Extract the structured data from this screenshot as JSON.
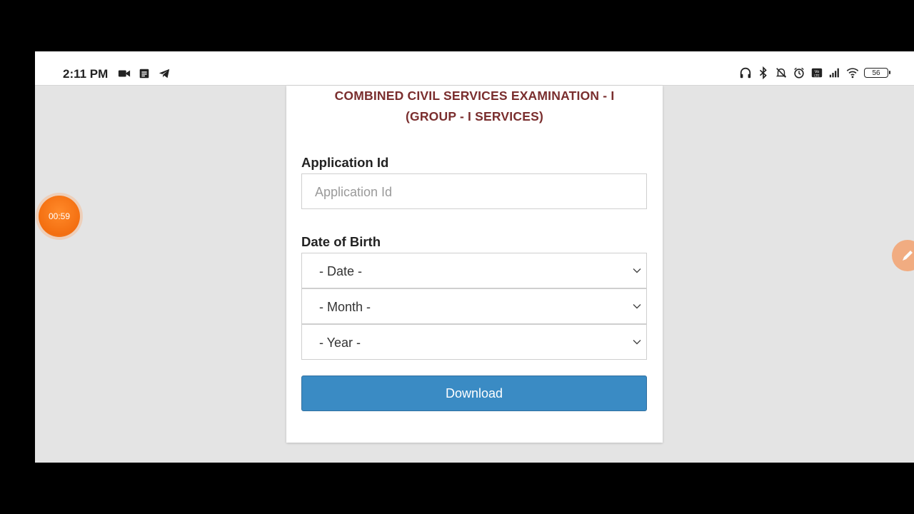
{
  "status_bar": {
    "time": "2:11 PM",
    "left_icons": [
      "video-camera-icon",
      "notes-icon",
      "telegram-icon"
    ],
    "right_icons": [
      "headphones-icon",
      "bluetooth-icon",
      "mute-bell-icon",
      "alarm-icon",
      "volte-icon",
      "signal-icon",
      "wifi-icon"
    ],
    "battery": "56"
  },
  "form": {
    "title_line1": "COMBINED CIVIL SERVICES EXAMINATION - I",
    "title_line2": "(GROUP - I SERVICES)",
    "application_id_label": "Application Id",
    "application_id_placeholder": "Application Id",
    "application_id_value": "",
    "dob_label": "Date of Birth",
    "date_select": "- Date -",
    "month_select": "- Month -",
    "year_select": "- Year -",
    "download_label": "Download"
  },
  "overlays": {
    "timer": "00:59",
    "edit_icon": "pencil-icon"
  },
  "colors": {
    "title": "#7a2e2e",
    "button": "#3a8bc4",
    "timer": "#f36e10"
  }
}
